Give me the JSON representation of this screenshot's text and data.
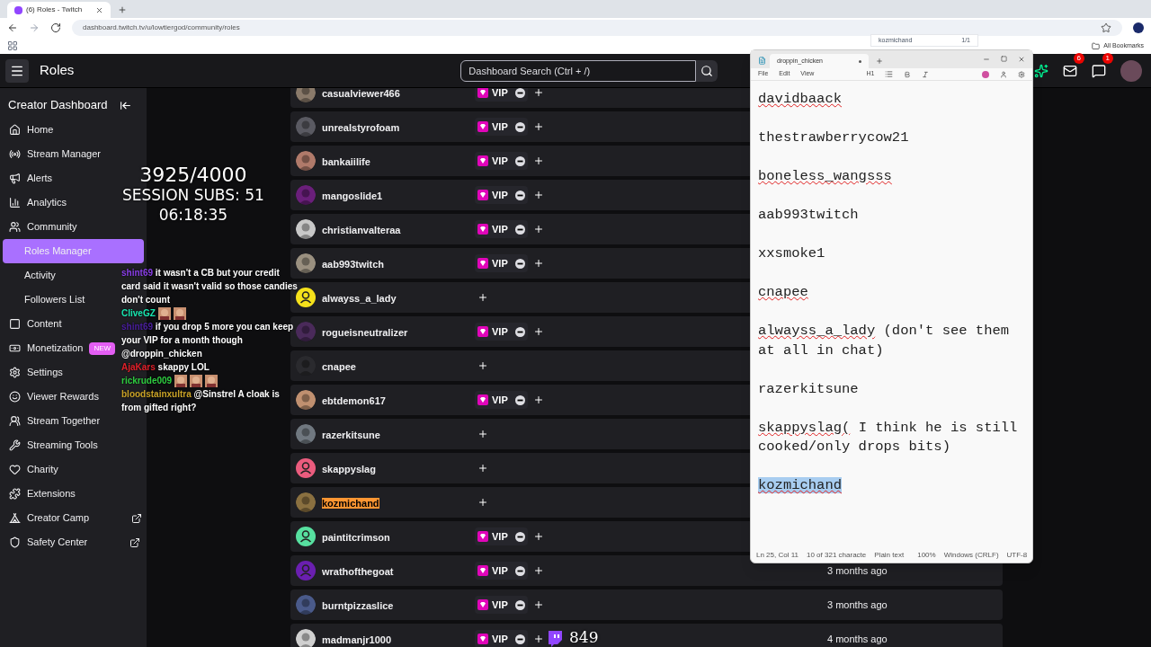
{
  "browser": {
    "tab_title": "(6) Roles - Twitch",
    "url": "dashboard.twitch.tv/u/lowtiergod/community/roles",
    "bookmarks_label": "All Bookmarks",
    "find_bar": {
      "query": "kozmichand",
      "count": "1/1"
    }
  },
  "header": {
    "title": "Roles",
    "search": {
      "placeholder": "Dashboard Search (Ctrl + /)"
    },
    "inbox_badge": "6",
    "whispers_badge": "1"
  },
  "sidebar": {
    "title": "Creator Dashboard",
    "items": [
      {
        "label": "Home",
        "kind": "home",
        "selected": false
      },
      {
        "label": "Stream Manager",
        "kind": "stream",
        "selected": false
      },
      {
        "label": "Alerts",
        "kind": "alerts",
        "selected": false
      },
      {
        "label": "Analytics",
        "kind": "analytics",
        "selected": false
      },
      {
        "label": "Community",
        "kind": "community",
        "selected": false
      },
      {
        "label": "Roles Manager",
        "kind": "sub",
        "selected": true
      },
      {
        "label": "Activity",
        "kind": "sub",
        "selected": false
      },
      {
        "label": "Followers List",
        "kind": "sub",
        "selected": false
      },
      {
        "label": "Content",
        "kind": "content",
        "selected": false
      },
      {
        "label": "Monetization",
        "kind": "monetization",
        "selected": false,
        "badge": "NEW"
      },
      {
        "label": "Settings",
        "kind": "settings",
        "selected": false
      },
      {
        "label": "Viewer Rewards",
        "kind": "rewards",
        "selected": false
      },
      {
        "label": "Stream Together",
        "kind": "together",
        "selected": false
      },
      {
        "label": "Streaming Tools",
        "kind": "tools",
        "selected": false
      },
      {
        "label": "Charity",
        "kind": "charity",
        "selected": false
      },
      {
        "label": "Extensions",
        "kind": "extensions",
        "selected": false
      },
      {
        "label": "Creator Camp",
        "kind": "camp",
        "selected": false,
        "external": true
      },
      {
        "label": "Safety Center",
        "kind": "safety",
        "selected": false,
        "external": true
      }
    ]
  },
  "roles": [
    {
      "name": "casualviewer466",
      "badge": "VIP",
      "highlighted": false
    },
    {
      "name": "unrealstyrofoam",
      "badge": "VIP",
      "highlighted": false
    },
    {
      "name": "bankaiilife",
      "badge": "VIP",
      "highlighted": false
    },
    {
      "name": "mangoslide1",
      "badge": "VIP",
      "highlighted": false
    },
    {
      "name": "christianvalteraa",
      "badge": "VIP",
      "highlighted": false
    },
    {
      "name": "aab993twitch",
      "badge": "VIP",
      "highlighted": false
    },
    {
      "name": "alwayss_a_lady",
      "avatar": {
        "kind": "default",
        "color": "#f5e11b"
      },
      "highlighted": false
    },
    {
      "name": "rogueisneutralizer",
      "badge": "VIP",
      "highlighted": false
    },
    {
      "name": "cnapee",
      "highlighted": false
    },
    {
      "name": "ebtdemon617",
      "badge": "VIP",
      "highlighted": false
    },
    {
      "name": "razerkitsune",
      "highlighted": false
    },
    {
      "name": "skappyslag",
      "avatar": {
        "kind": "default",
        "color": "#eb5c7e"
      },
      "highlighted": false
    },
    {
      "name": "kozmichand",
      "highlighted": true
    },
    {
      "name": "paintitcrimson",
      "badge": "VIP",
      "avatar": {
        "kind": "default",
        "color": "#57e0a0"
      },
      "highlighted": false
    },
    {
      "name": "wrathofthegoat",
      "badge": "VIP",
      "avatar": {
        "kind": "default",
        "color": "#6a1fb0"
      },
      "highlighted": false,
      "date": "3 months ago"
    },
    {
      "name": "burntpizzaslice",
      "badge": "VIP",
      "highlighted": false,
      "date": "3 months ago"
    },
    {
      "name": "madmanjr1000",
      "badge": "VIP",
      "highlighted": false,
      "date": "4 months ago"
    }
  ],
  "stream_overlay": {
    "stats": [
      "3925/4000",
      "SESSION SUBS: 51",
      "06:18:35"
    ],
    "bits": "849",
    "chat": [
      {
        "user": "shint69",
        "color": "#8a3fe8",
        "text": "it wasn't a CB but your credit card said it wasn't valid so those candies don't count"
      },
      {
        "user": "CliveGZ",
        "color": "#19e6b0"
      },
      {
        "user": "shint69",
        "color": "#4b1fa0",
        "text": "if you drop 5 more you can keep your VIP for a month though"
      },
      {
        "text": "@droppin_chicken"
      },
      {
        "user": "AjaKars",
        "color": "#e0202a",
        "text": "skappy LOL"
      },
      {
        "user": "rickrude009",
        "color": "#2ecc40"
      },
      {
        "user": "bloodstainxultra",
        "color": "#c9a227",
        "text": "@Sinstrel A cloak is from gifted right?"
      }
    ]
  },
  "notepad": {
    "tab": "droppin_chicken",
    "menu": [
      "File",
      "Edit",
      "View"
    ],
    "heading_control": "H1",
    "lines": [
      {
        "word": "davidbaack",
        "flagged": true,
        "selected": false
      },
      {
        "word": "thestrawberrycow21",
        "flagged": false,
        "selected": false
      },
      {
        "word": "boneless_wangsss",
        "flagged": true,
        "selected": false
      },
      {
        "word": "aab993twitch",
        "flagged": false,
        "selected": false
      },
      {
        "word": "xxsmoke1",
        "flagged": false,
        "selected": false
      },
      {
        "word": "cnapee",
        "flagged": true,
        "selected": false
      },
      {
        "word": "alwayss_a_lady",
        "rest": " (don't see them at all in chat)",
        "flagged": true,
        "selected": false
      },
      {
        "word": "razerkitsune",
        "flagged": false,
        "selected": false
      },
      {
        "word": "skappyslag(",
        "rest": " I think he is still cooked/only drops bits)",
        "flagged": true,
        "selected": false
      },
      {
        "word": "kozmichand",
        "flagged": true,
        "selected": true
      }
    ],
    "status": [
      "Ln 25, Col 11",
      "10 of 321 characte",
      "Plain text",
      "100%",
      "Windows (CRLF)",
      "UTF-8"
    ]
  }
}
